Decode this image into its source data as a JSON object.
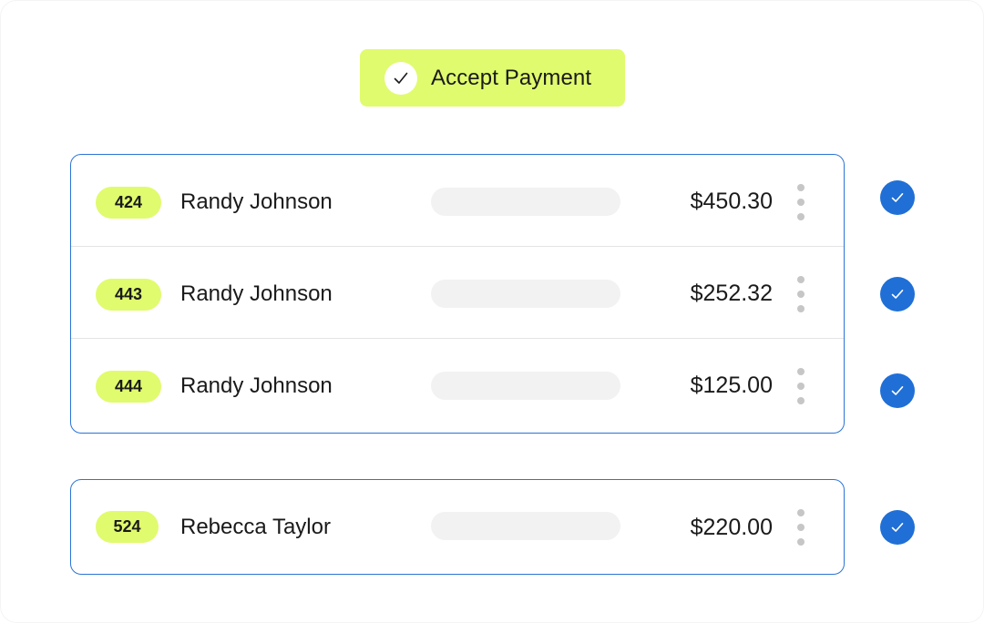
{
  "accept_button": {
    "label": "Accept Payment",
    "icon": "check-icon"
  },
  "colors": {
    "accent_lime": "#e0fb6e",
    "card_border_blue": "#2b74d6",
    "check_blue": "#1f6fd6",
    "placeholder_gray": "#f2f2f2",
    "kebab_gray": "#c6c6c6"
  },
  "group_one": {
    "rows": [
      {
        "id": "424",
        "name": "Randy Johnson",
        "amount": "$450.30",
        "checked": true
      },
      {
        "id": "443",
        "name": "Randy Johnson",
        "amount": "$252.32",
        "checked": true
      },
      {
        "id": "444",
        "name": "Randy Johnson",
        "amount": "$125.00",
        "checked": true
      }
    ]
  },
  "group_two": {
    "rows": [
      {
        "id": "524",
        "name": "Rebecca Taylor",
        "amount": "$220.00",
        "checked": true
      }
    ]
  }
}
